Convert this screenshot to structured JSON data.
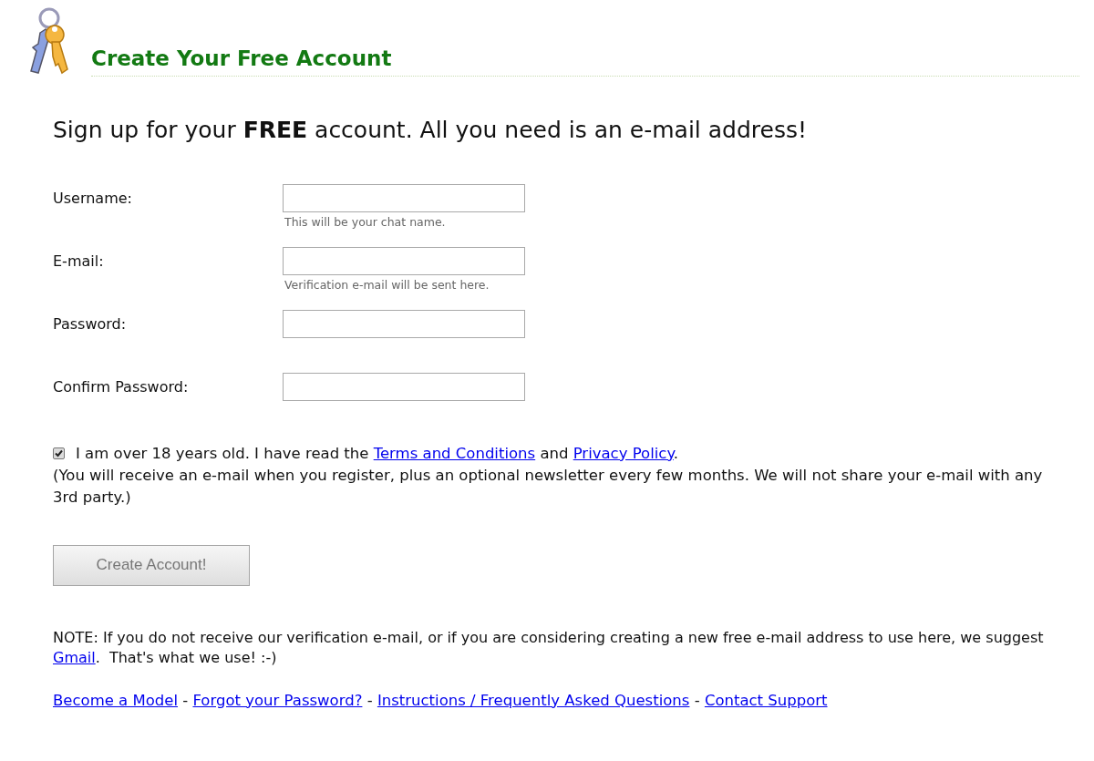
{
  "header": {
    "title": "Create Your Free Account"
  },
  "tagline": "Sign up for your **FREE** account.  All you need is an e-mail address!",
  "fields": [
    {
      "label": "Username:",
      "hint": "This will be your chat name."
    },
    {
      "label": "E-mail:",
      "hint": "Verification e-mail will be sent here."
    },
    {
      "label": "Password:"
    },
    {
      "label": "Confirm Password:"
    }
  ],
  "agreement": {
    "checked": true,
    "segments": [
      {
        "kind": "text",
        "text": "I am over 18 years old. I have read the "
      },
      {
        "kind": "link",
        "text": "Terms and Conditions"
      },
      {
        "kind": "text",
        "text": " and "
      },
      {
        "kind": "link",
        "text": "Privacy Policy"
      },
      {
        "kind": "text",
        "text": "."
      }
    ],
    "note": "(You will receive an e-mail when you register, plus an optional newsletter every few months. We will not share your e-mail with any 3rd party.)"
  },
  "submit": {
    "label": "Create Account!"
  },
  "note": [
    {
      "kind": "text",
      "text": "NOTE: If you do not receive our verification e-mail, or if you are considering creating a new free e-mail address to use here, we suggest "
    },
    {
      "kind": "link",
      "text": "Gmail"
    },
    {
      "kind": "text",
      "text": ".  That's what we use! :-)"
    }
  ],
  "footer_links": [
    {
      "kind": "link",
      "text": "Become a Model"
    },
    {
      "kind": "text",
      "text": " - "
    },
    {
      "kind": "link",
      "text": "Forgot your Password?"
    },
    {
      "kind": "text",
      "text": " - "
    },
    {
      "kind": "link",
      "text": "Instructions / Frequently Asked Questions"
    },
    {
      "kind": "text",
      "text": " - "
    },
    {
      "kind": "link",
      "text": "Contact Support"
    }
  ]
}
